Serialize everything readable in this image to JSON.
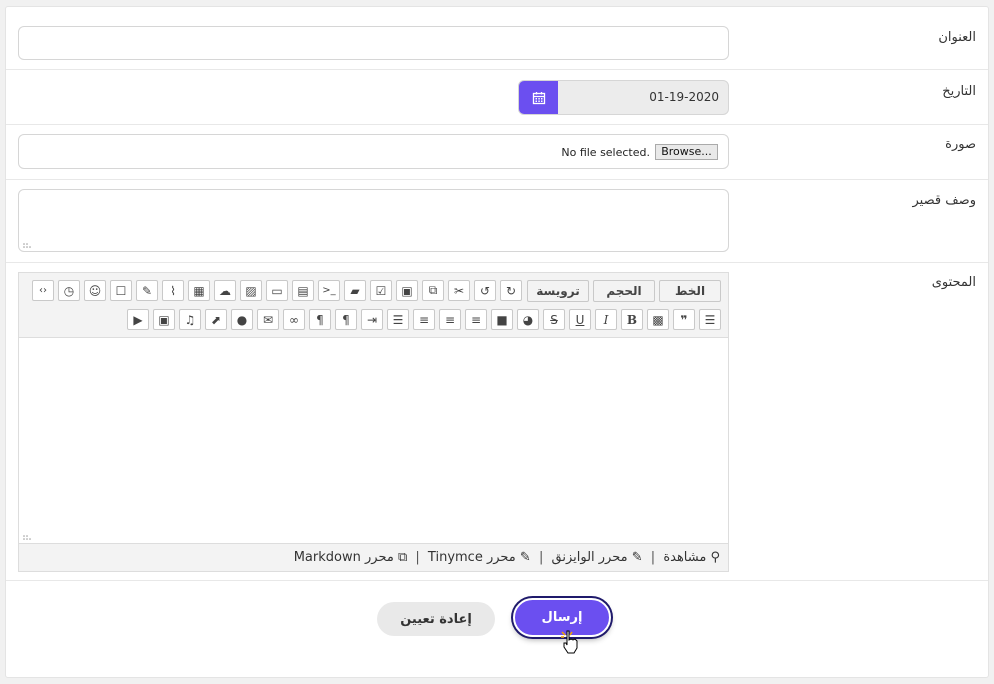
{
  "form": {
    "title_label": "العنوان",
    "title_value": "",
    "date_label": "التاريخ",
    "date_value": "01-19-2020",
    "image_label": "صورة",
    "browse_label": "Browse...",
    "file_status": "No file selected.",
    "short_desc_label": "وصف قصير",
    "content_label": "المحتوى"
  },
  "toolbar": {
    "font_label": "الخط",
    "size_label": "الحجم",
    "heading_label": "ترويسة",
    "icons_row1": [
      "redo-icon",
      "undo-icon",
      "cut-icon",
      "copy-icon",
      "paste-icon",
      "checkbox-icon",
      "eraser-icon",
      "terminal-icon",
      "file-icon",
      "box-icon",
      "image-icon",
      "upload-cloud-icon",
      "archive-icon",
      "link-clip-icon",
      "edit-icon",
      "edit-square-icon",
      "smile-icon",
      "history-icon",
      "code-icon"
    ],
    "icons_row2": [
      "list-icon",
      "quote-icon",
      "qrcode-icon",
      "bold-icon",
      "italic-icon",
      "underline-icon",
      "strikethrough-icon",
      "palette-icon",
      "square-icon",
      "align-right-icon",
      "align-center-icon",
      "align-left-icon",
      "justify-icon",
      "indent-icon",
      "pilcrow-rtl-icon",
      "pilcrow-icon",
      "link-icon",
      "mail-icon",
      "comment-icon",
      "image-up-icon",
      "music-icon",
      "video-icon",
      "youtube-icon"
    ]
  },
  "editor_modes": {
    "preview": "مشاهدة",
    "wysiwyg": "محرر الوايزنق",
    "tinymce": "محرر Tinymce",
    "markdown": "محرر Markdown"
  },
  "actions": {
    "submit_label": "إرسال",
    "reset_label": "إعادة تعيين"
  },
  "colors": {
    "accent": "#6b4ff0",
    "border": "#d6d6d6"
  }
}
